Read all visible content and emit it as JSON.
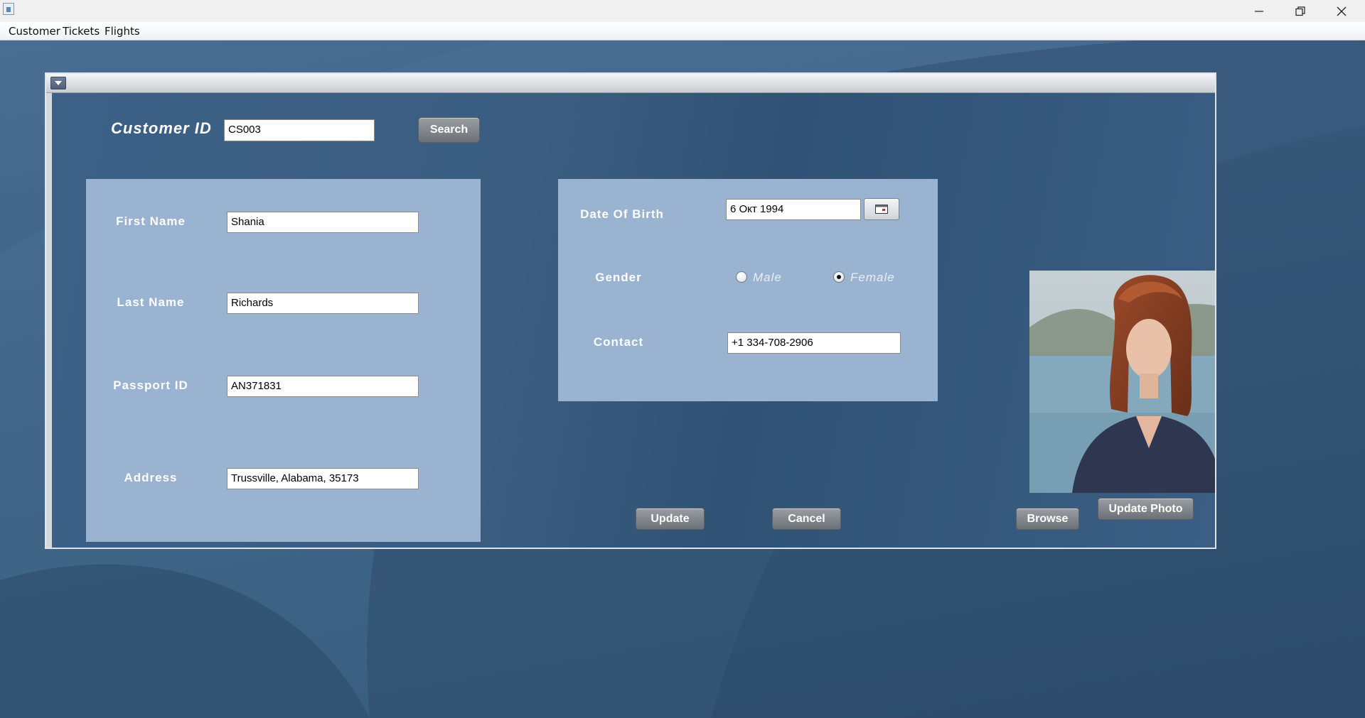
{
  "window": {
    "controls": [
      "minimize-icon",
      "restore-icon",
      "close-icon"
    ]
  },
  "menu": [
    "Customer",
    "Tickets",
    "Flights"
  ],
  "form": {
    "customer_id_label": "Customer ID",
    "customer_id_value": "CS003",
    "search_label": "Search",
    "first_name_label": "First Name",
    "first_name_value": "Shania",
    "last_name_label": "Last Name",
    "last_name_value": "Richards",
    "passport_label": "Passport ID",
    "passport_value": "AN371831",
    "address_label": "Address",
    "address_value": "Trussville, Alabama, 35173",
    "dob_label": "Date Of Birth",
    "dob_value": "6 Окт 1994",
    "gender_label": "Gender",
    "gender_options": [
      "Male",
      "Female"
    ],
    "gender_selected": "Female",
    "contact_label": "Contact",
    "contact_value": "+1 334-708-2906"
  },
  "buttons": {
    "update_photo": "Update Photo",
    "update": "Update",
    "cancel": "Cancel",
    "browse": "Browse"
  },
  "colors": {
    "desktop": "#3d5f80",
    "panel": "#99b3d0",
    "button": "#7d8188"
  }
}
